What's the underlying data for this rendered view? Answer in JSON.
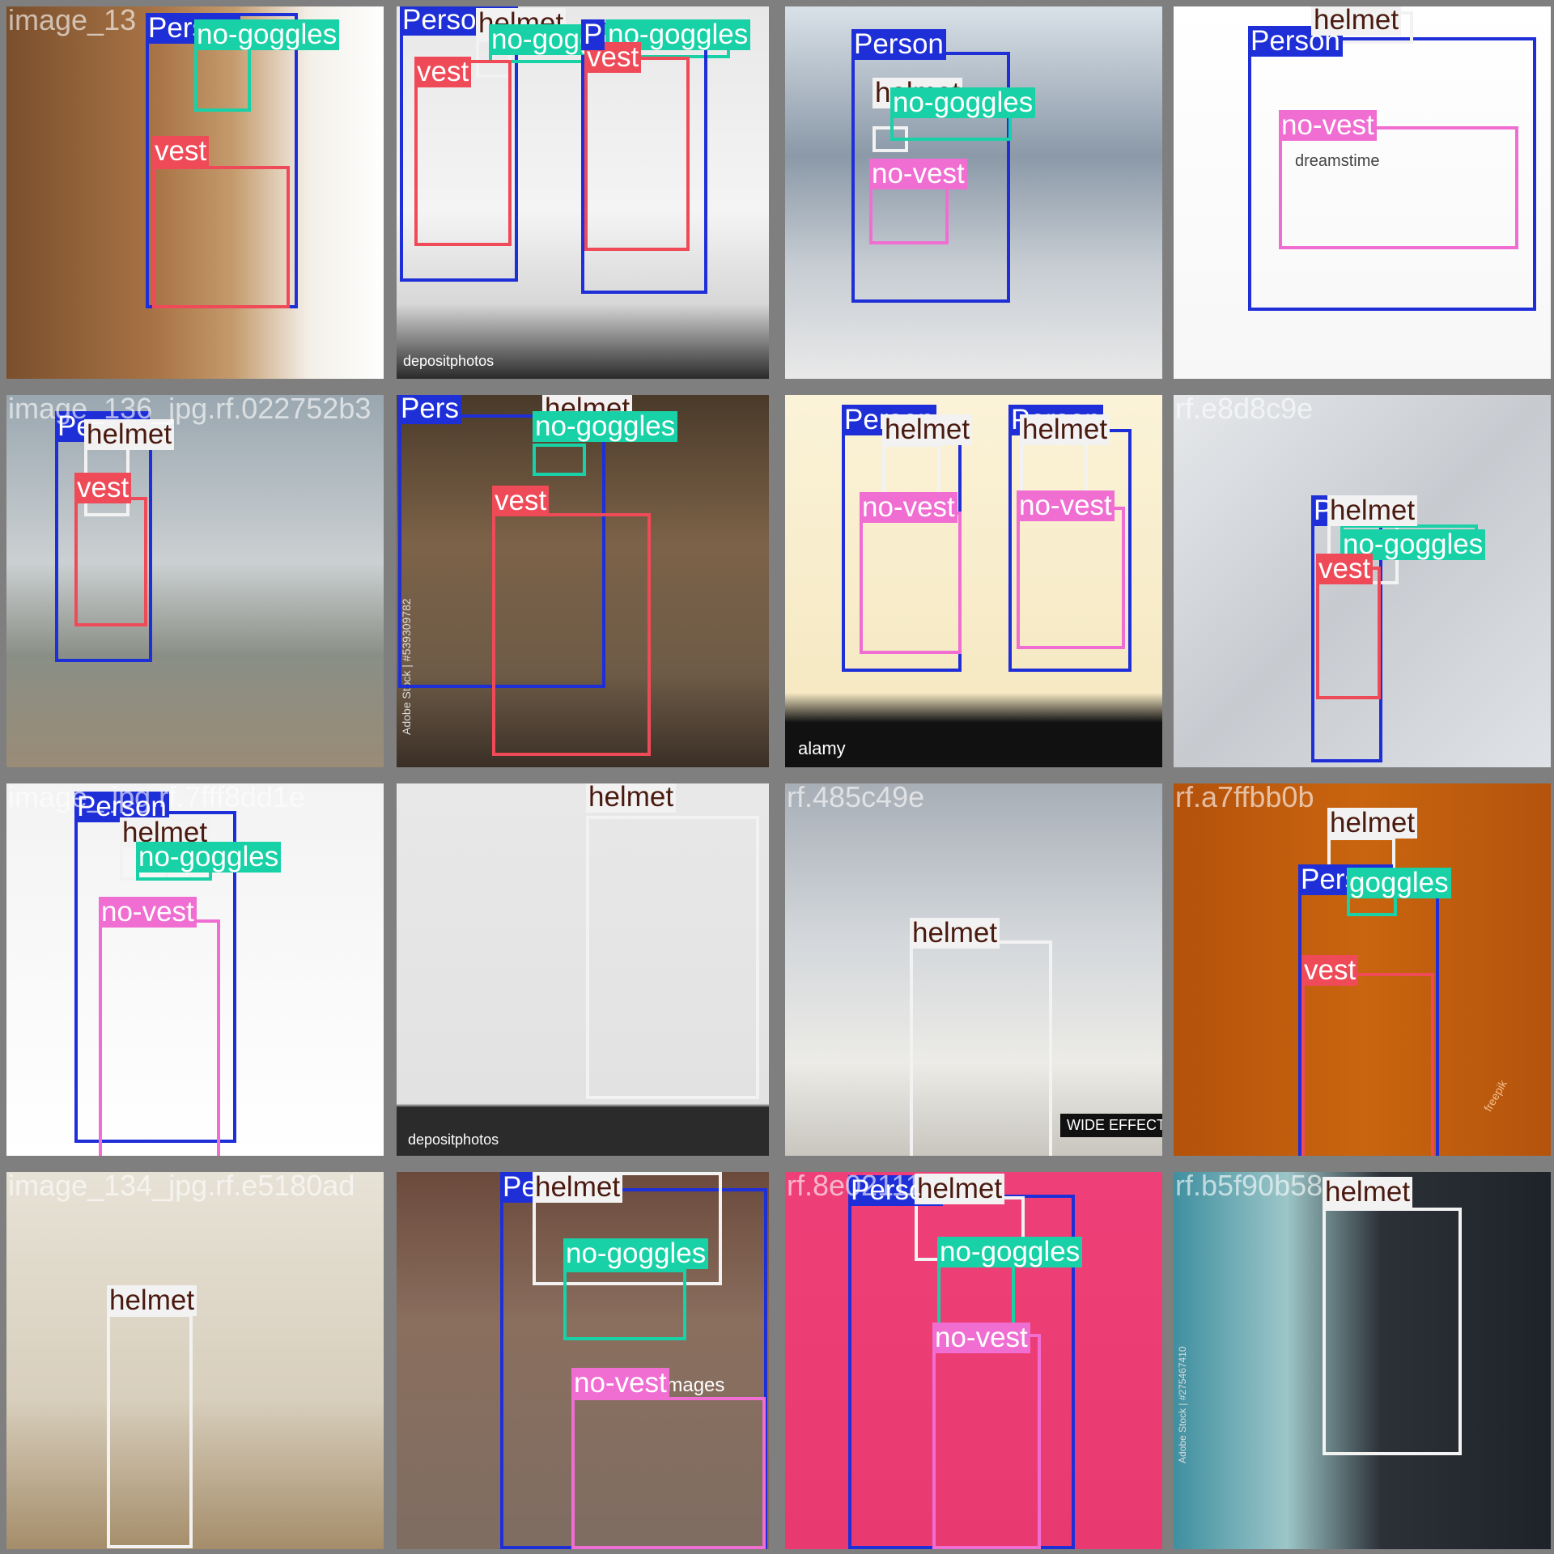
{
  "classes": {
    "Person": {
      "color": "#1f2fd8",
      "text_color": "#ffffff"
    },
    "helmet": {
      "color": "#f2f2f2",
      "text_color": "#4a1a10"
    },
    "no-goggles": {
      "color": "#19d1a6",
      "text_color": "#ffffff"
    },
    "vest": {
      "color": "#ef4a57",
      "text_color": "#ffffff"
    },
    "no-vest": {
      "color": "#f06ed2",
      "text_color": "#ffffff"
    }
  },
  "tiles": [
    {
      "filename": "image_13",
      "watermarks": [],
      "detections": [
        {
          "class": "Person",
          "label": "Person"
        },
        {
          "class": "no-goggles",
          "label": "no-goggles"
        },
        {
          "class": "vest",
          "label": "vest"
        }
      ]
    },
    {
      "filename": "",
      "watermarks": [
        "depositphotos"
      ],
      "detections": [
        {
          "class": "Person",
          "label": "Person"
        },
        {
          "class": "helmet",
          "label": "helmet"
        },
        {
          "class": "no-goggles",
          "label": "no-goggles"
        },
        {
          "class": "no-goggles",
          "label": "no-goggles"
        },
        {
          "class": "vest",
          "label": "vest"
        },
        {
          "class": "vest",
          "label": "vest"
        },
        {
          "class": "Person",
          "label": "P"
        }
      ]
    },
    {
      "filename": "",
      "watermarks": [],
      "detections": [
        {
          "class": "Person",
          "label": "Person"
        },
        {
          "class": "helmet",
          "label": "helmet"
        },
        {
          "class": "no-goggles",
          "label": "no-goggles"
        },
        {
          "class": "no-vest",
          "label": "no-vest"
        }
      ]
    },
    {
      "filename": "",
      "watermarks": [
        "dreamstime"
      ],
      "detections": [
        {
          "class": "Person",
          "label": "Person"
        },
        {
          "class": "helmet",
          "label": "helmet"
        },
        {
          "class": "no-vest",
          "label": "no-vest"
        }
      ]
    },
    {
      "filename": "image_136_jpg.rf.022752b3",
      "watermarks": [],
      "detections": [
        {
          "class": "Person",
          "label": "Person"
        },
        {
          "class": "helmet",
          "label": "helmet"
        },
        {
          "class": "vest",
          "label": "vest"
        }
      ]
    },
    {
      "filename": "",
      "watermarks": [
        "Adobe Stock | #539309782"
      ],
      "detections": [
        {
          "class": "Person",
          "label": "Pers"
        },
        {
          "class": "helmet",
          "label": "helmet"
        },
        {
          "class": "no-goggles",
          "label": "no-goggles"
        },
        {
          "class": "vest",
          "label": "vest"
        }
      ]
    },
    {
      "filename": "",
      "watermarks": [
        "alamy"
      ],
      "detections": [
        {
          "class": "Person",
          "label": "Person"
        },
        {
          "class": "Person",
          "label": "Person"
        },
        {
          "class": "helmet",
          "label": "helmet"
        },
        {
          "class": "helmet",
          "label": "helmet"
        },
        {
          "class": "no-vest",
          "label": "no-vest"
        },
        {
          "class": "no-vest",
          "label": "no-vest"
        }
      ]
    },
    {
      "filename": "rf.e8d8c9e",
      "watermarks": [],
      "detections": [
        {
          "class": "Person",
          "label": "P"
        },
        {
          "class": "helmet",
          "label": "helmet"
        },
        {
          "class": "no-goggles",
          "label": "no-goggles"
        },
        {
          "class": "vest",
          "label": "vest"
        }
      ]
    },
    {
      "filename": "image_ jpg.rf.7fff8dd1e",
      "watermarks": [],
      "detections": [
        {
          "class": "Person",
          "label": "Person"
        },
        {
          "class": "helmet",
          "label": "helmet"
        },
        {
          "class": "no-goggles",
          "label": "no-goggles"
        },
        {
          "class": "no-vest",
          "label": "no-vest"
        }
      ]
    },
    {
      "filename": "",
      "watermarks": [
        "depositphotos"
      ],
      "detections": [
        {
          "class": "helmet",
          "label": "helmet"
        }
      ]
    },
    {
      "filename": "rf.485c49e",
      "watermarks": [
        "WIDE EFFECT"
      ],
      "detections": [
        {
          "class": "helmet",
          "label": "helmet"
        }
      ]
    },
    {
      "filename": "rf.a7ffbb0b",
      "watermarks": [
        "freepik"
      ],
      "detections": [
        {
          "class": "helmet",
          "label": "helmet"
        },
        {
          "class": "Person",
          "label": "Person"
        },
        {
          "class": "no-goggles",
          "label": "goggles"
        },
        {
          "class": "vest",
          "label": "vest"
        }
      ]
    },
    {
      "filename": "image_134_jpg.rf.e5180ad",
      "watermarks": [],
      "detections": [
        {
          "class": "helmet",
          "label": "helmet"
        }
      ]
    },
    {
      "filename": "",
      "watermarks": [
        "gettyimages"
      ],
      "detections": [
        {
          "class": "Person",
          "label": "Pe"
        },
        {
          "class": "helmet",
          "label": "helmet"
        },
        {
          "class": "no-goggles",
          "label": "no-goggles"
        },
        {
          "class": "no-vest",
          "label": "no-vest"
        }
      ]
    },
    {
      "filename": "rf.8e02111",
      "watermarks": [],
      "detections": [
        {
          "class": "Person",
          "label": "Person"
        },
        {
          "class": "helmet",
          "label": "helmet"
        },
        {
          "class": "no-goggles",
          "label": "no-goggles"
        },
        {
          "class": "no-vest",
          "label": "no-vest"
        }
      ]
    },
    {
      "filename": "rf.b5f90b58",
      "watermarks": [
        "Adobe Stock | #275467410"
      ],
      "detections": [
        {
          "class": "helmet",
          "label": "helmet"
        }
      ]
    }
  ]
}
